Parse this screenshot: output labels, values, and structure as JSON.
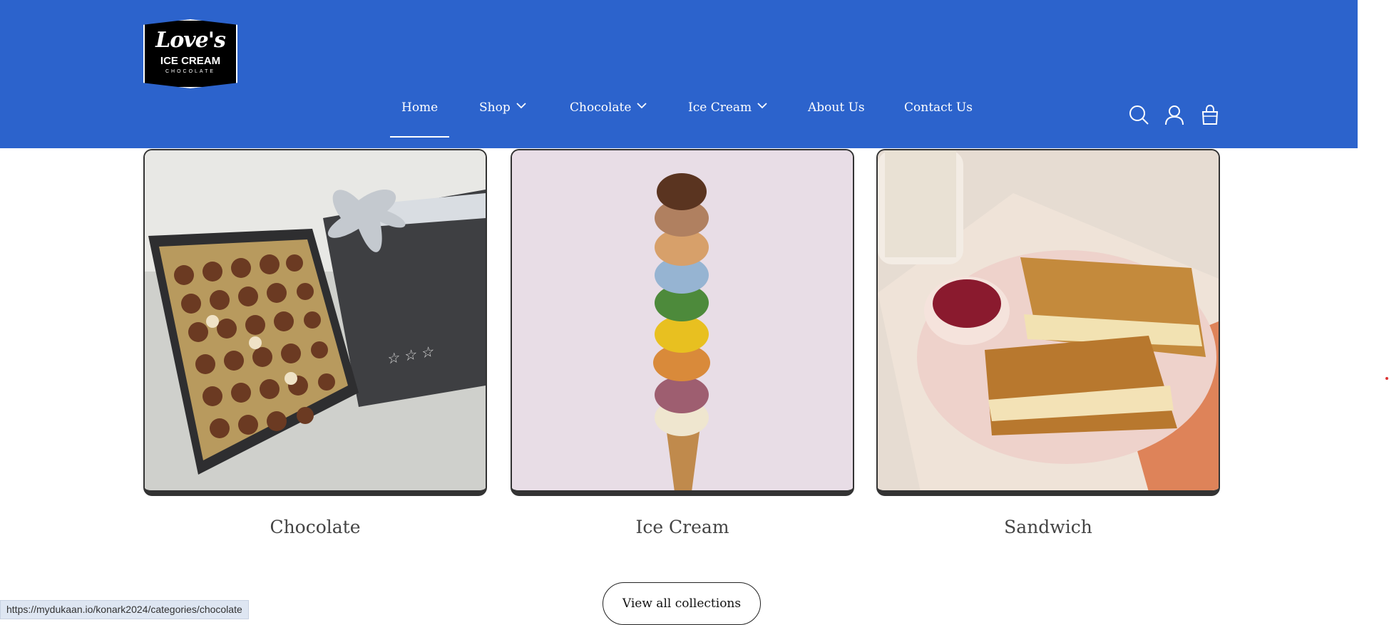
{
  "brand": {
    "logo_line1": "Love's",
    "logo_line2": "ICE CREAM",
    "logo_line3": "CHOCOLATE"
  },
  "nav": {
    "items": [
      {
        "label": "Home",
        "has_dropdown": false,
        "active": true
      },
      {
        "label": "Shop",
        "has_dropdown": true
      },
      {
        "label": "Chocolate",
        "has_dropdown": true
      },
      {
        "label": "Ice Cream",
        "has_dropdown": true
      },
      {
        "label": "About Us",
        "has_dropdown": false
      },
      {
        "label": "Contact Us",
        "has_dropdown": false
      }
    ]
  },
  "header_icons": [
    "search-icon",
    "user-icon",
    "bag-icon"
  ],
  "collections": [
    {
      "label": "Chocolate"
    },
    {
      "label": "Ice Cream"
    },
    {
      "label": "Sandwich"
    }
  ],
  "view_all_label": "View all collections",
  "status_url": "https://mydukaan.io/konark2024/categories/chocolate",
  "colors": {
    "header_bg": "#2c63cc",
    "text_on_header": "#ffffff",
    "card_border": "#333333"
  }
}
